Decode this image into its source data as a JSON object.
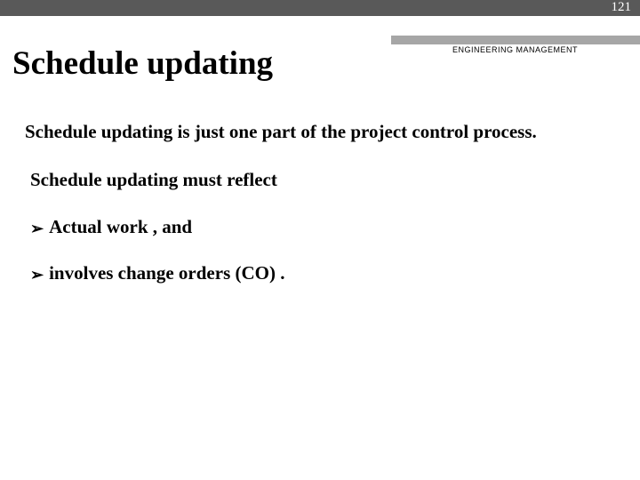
{
  "page_number": "121",
  "header_label": "ENGINEERING MANAGEMENT",
  "title": "Schedule updating",
  "intro": "Schedule updating is just one part of the project control process.",
  "reflect_line": "Schedule updating must reflect",
  "bullets": {
    "b1": "Actual work ,  and",
    "b2": "involves change orders (CO) ."
  },
  "bullet_glyph": "➢"
}
